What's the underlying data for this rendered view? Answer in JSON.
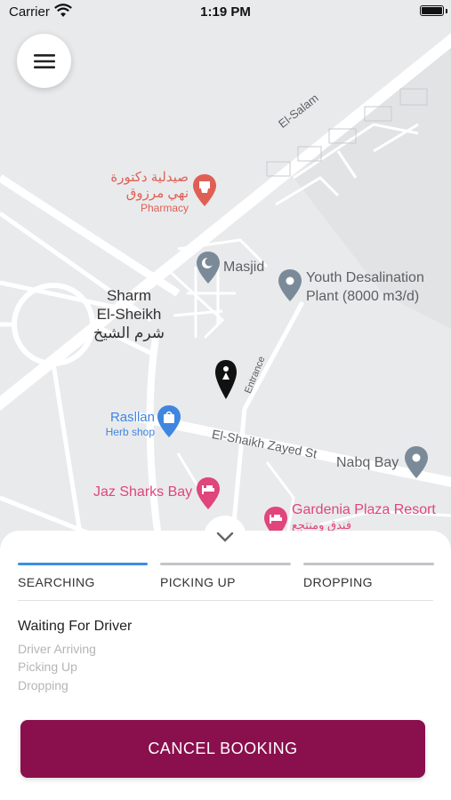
{
  "status_bar": {
    "carrier": "Carrier",
    "time": "1:19 PM"
  },
  "menu": {
    "icon": "hamburger-icon"
  },
  "map": {
    "roads": [
      "El-Salam",
      "Entrance",
      "El-Shaikh Zayed St"
    ],
    "city": {
      "line1": "Sharm",
      "line2": "El-Sheikh",
      "arabic": "شرم الشيخ"
    },
    "places": {
      "pharmacy": {
        "arabic1": "صيدلية دكتورة",
        "arabic2": "نهي مرزوق",
        "category": "Pharmacy",
        "color": "#e05f55"
      },
      "masjid": {
        "name": "Masjid",
        "color": "#7b8a99"
      },
      "desalination": {
        "line1": "Youth Desalination",
        "line2": "Plant (8000 m3/d)",
        "color": "#7b8a99"
      },
      "rasllan": {
        "name": "Rasllan",
        "category": "Herb shop",
        "color": "#3f86e0"
      },
      "nabq": {
        "name": "Nabq Bay",
        "color": "#7b8a99"
      },
      "jaz": {
        "name": "Jaz Sharks Bay",
        "color": "#e0457b"
      },
      "gardenia": {
        "name": "Gardenia Plaza Resort",
        "arabic": "فندق ومنتجع",
        "color": "#e0457b"
      }
    },
    "marker_icon": "driver-pin-icon"
  },
  "trip": {
    "steps": [
      {
        "label": "SEARCHING",
        "active": true
      },
      {
        "label": "PICKING UP",
        "active": false
      },
      {
        "label": "DROPPING",
        "active": false
      }
    ],
    "status_title": "Waiting For Driver",
    "status_subs": [
      "Driver Arriving",
      "Picking Up",
      "Dropping"
    ],
    "cancel_label": "CANCEL BOOKING"
  },
  "colors": {
    "accent_blue": "#3a8ee6",
    "inactive_bar": "#c2c4c7",
    "cancel": "#8a0f4d"
  }
}
